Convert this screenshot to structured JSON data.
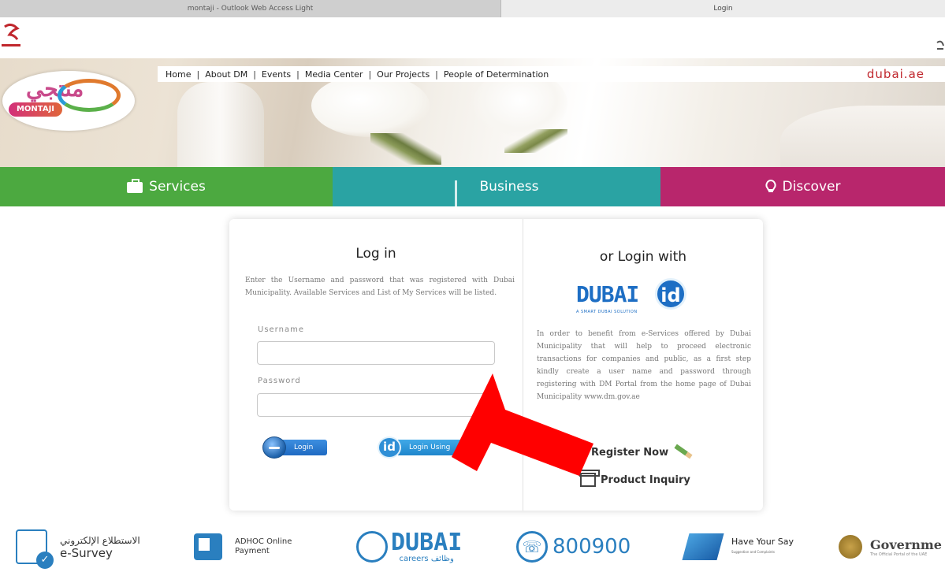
{
  "browser": {
    "tabs": [
      {
        "label": "montaji - Outlook Web Access Light"
      },
      {
        "label": "Login"
      }
    ]
  },
  "top_nav": {
    "links": [
      "Home",
      "About DM",
      "Events",
      "Media Center",
      "Our Projects",
      "People of Determination"
    ],
    "dubai_ae": "dubai.ae"
  },
  "brand": {
    "montaji_arabic": "منتجي",
    "montaji_latin": "MONTAJI"
  },
  "categories": [
    {
      "label": "Services",
      "icon": "briefcase-icon",
      "color": "#4ca940"
    },
    {
      "label": "Business",
      "icon": "bar-chart-icon",
      "color": "#2aa3a3"
    },
    {
      "label": "Discover",
      "icon": "lightbulb-icon",
      "color": "#b8266c"
    }
  ],
  "login": {
    "title": "Log in",
    "description": "Enter the Username and password that was registered with Dubai Municipality. Available Services and List of My Services will be listed.",
    "username_label": "Username",
    "username_value": "",
    "password_label": "Password",
    "password_value": "",
    "login_button": "Login",
    "login_using_button": "Login Using",
    "id_badge": "id"
  },
  "alt_login": {
    "title": "or Login with",
    "logo_word": "DUBAI",
    "logo_id": "id",
    "logo_tag": "A SMART DUBAI SOLUTION",
    "description": "In order to benefit from e-Services offered by Dubai Municipality that will help to proceed electronic transactions for companies and public, as a first step kindly create a user name and password through registering with DM Portal from the home page of Dubai Municipality www.dm.gov.ae",
    "register_now": "Register Now",
    "product_inquiry": "Product Inquiry"
  },
  "footer": {
    "esurvey_ar": "الاستطلاع الإلكتروني",
    "esurvey_en": "e-Survey",
    "adhoc_line1": "ADHOC Online",
    "adhoc_line2": "Payment",
    "careers_word": "DUBAI",
    "careers_sub": "careers وظائف",
    "phone_number": "800900",
    "have_your_say": "Have Your Say",
    "have_your_say_sub": "Suggestion and Complaints",
    "government": "Governme",
    "government_sub": "The Official Portal of the UAE"
  },
  "colors": {
    "services": "#4ca940",
    "business": "#2aa3a3",
    "discover": "#b8266c",
    "annotation_arrow": "#ff0000"
  }
}
